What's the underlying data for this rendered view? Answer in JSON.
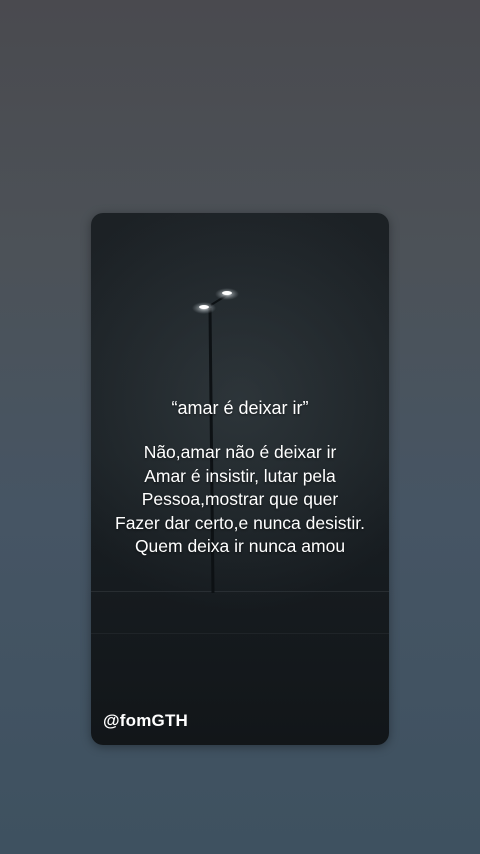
{
  "quote": {
    "title": "“amar é deixar ir”",
    "lines": [
      "Não,amar não é deixar ir",
      "Amar é insistir, lutar pela",
      "Pessoa,mostrar que quer",
      "Fazer dar certo,e nunca desistir.",
      "Quem deixa ir nunca amou"
    ]
  },
  "author": {
    "handle": "@fomGTH"
  },
  "colors": {
    "text": "#ffffff",
    "card_background": "#1a2024"
  }
}
